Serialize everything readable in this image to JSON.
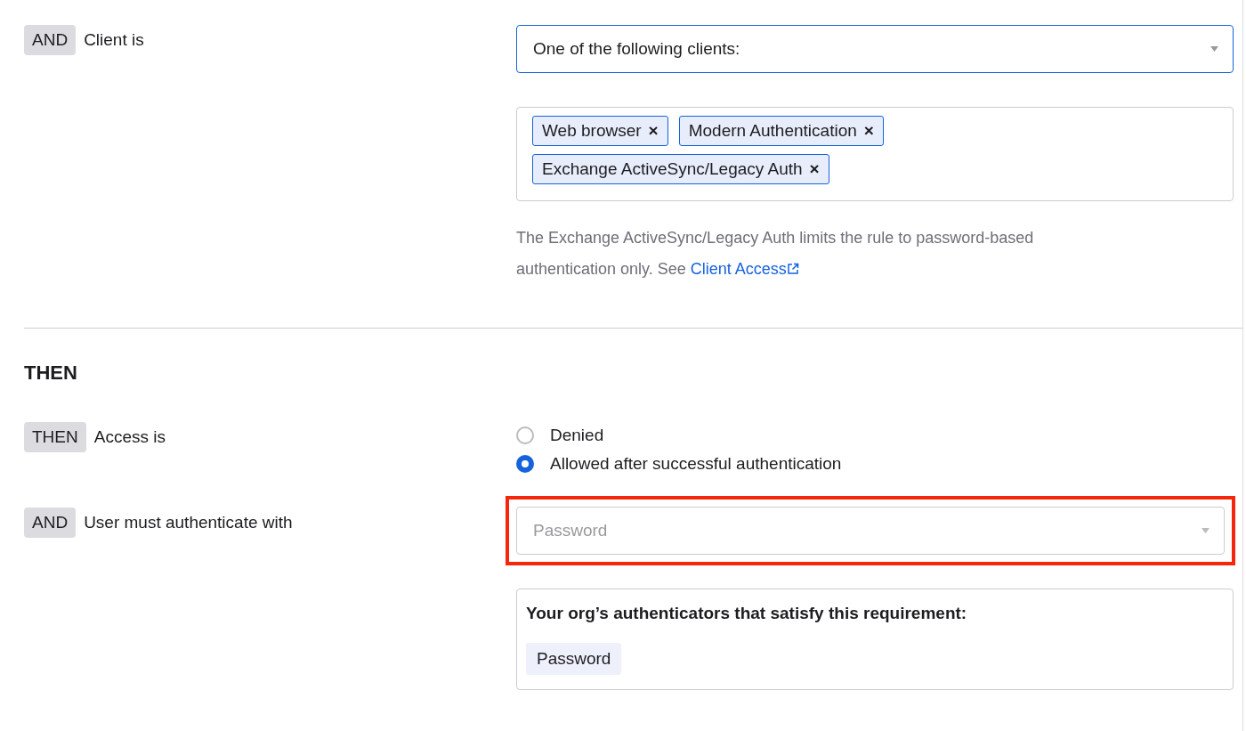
{
  "client_condition": {
    "operator": "AND",
    "label": "Client is",
    "select": {
      "value": "One of the following clients:",
      "focused": true
    },
    "tags": [
      {
        "label": "Web browser",
        "remove": "×"
      },
      {
        "label": "Modern Authentication",
        "remove": "×"
      },
      {
        "label": "Exchange ActiveSync/Legacy Auth",
        "remove": "×"
      }
    ],
    "help_text": "The Exchange ActiveSync/Legacy Auth limits the rule to password-based authentication only. See",
    "help_link": "Client Access"
  },
  "then_section": {
    "heading": "THEN",
    "access": {
      "operator": "THEN",
      "label": "Access is",
      "options": [
        {
          "label": "Denied",
          "selected": false
        },
        {
          "label": "Allowed after successful authentication",
          "selected": true
        }
      ]
    },
    "authenticate": {
      "operator": "AND",
      "label": "User must authenticate with",
      "select": {
        "placeholder": "Password",
        "disabled": true,
        "highlighted": true
      },
      "authenticators_box": {
        "title": "Your org’s authenticators that satisfy this requirement:",
        "items": [
          "Password"
        ]
      }
    }
  }
}
